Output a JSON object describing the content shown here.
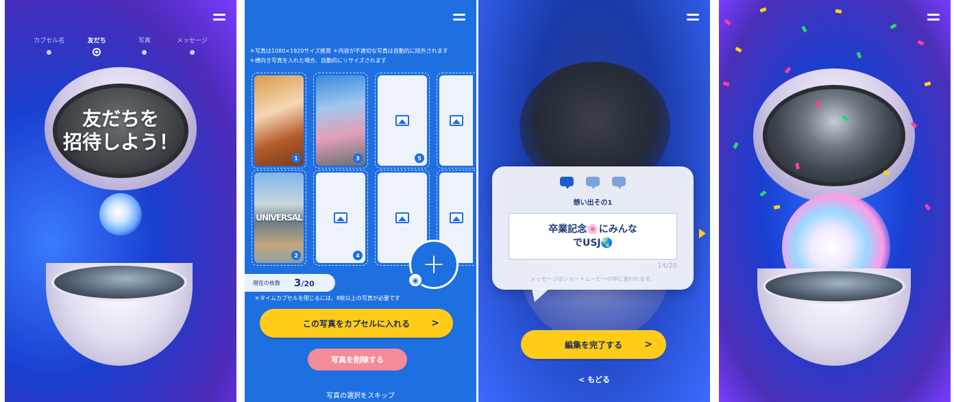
{
  "screen1": {
    "steps": [
      {
        "label": "カプセル名"
      },
      {
        "label": "友だち"
      },
      {
        "label": "写真"
      },
      {
        "label": "メッセージ"
      }
    ],
    "active_step": 1,
    "headline_line1": "友だちを",
    "headline_line2": "招待しよう！"
  },
  "screen2": {
    "notice_line1": "＊写真は1080×1920サイズ推奨 ＊内容が不適切な写真は自動的に除外されます",
    "notice_line2": "＊横向き写真を入れた場合、自動的にリサイズされます",
    "slots": [
      {
        "number": "1",
        "filled": true
      },
      {
        "number": "3",
        "filled": true
      },
      {
        "number": "5",
        "filled": false
      },
      {
        "number": "",
        "filled": false
      },
      {
        "number": "2",
        "filled": true,
        "photo_text": "UNIVERSAL"
      },
      {
        "number": "4",
        "filled": false
      },
      {
        "number": "",
        "filled": false
      },
      {
        "number": "",
        "filled": false
      }
    ],
    "count_label": "現在の枚数",
    "count_current": "3",
    "count_total": "/20",
    "hint": "＊タイムカプセルを閉じるには、8枚以上の写真が必要です",
    "add_button_label": "+",
    "primary_button": "この写真をカプセルに入れる",
    "primary_arrow": ">",
    "delete_button": "写真を削除する",
    "skip_link": "写真の選択をスキップ"
  },
  "screen3": {
    "memory_title": "想い出その1",
    "message_line1": "卒業記念🌸にみんな",
    "message_line2": "でUSJ🌏",
    "char_count": "14/20",
    "message_note": "メッセージはショートムービーの中に使われます。",
    "complete_button": "編集を完了する",
    "complete_arrow": ">",
    "back_link": "< もどる"
  },
  "colors": {
    "accent": "#1e6fe0",
    "cta_yellow": "#ffcc1a",
    "delete_pink": "#f48b98"
  },
  "icons": {
    "menu": "hamburger-icon",
    "image_placeholder": "image-icon",
    "camera": "camera-icon",
    "add": "plus-icon"
  }
}
